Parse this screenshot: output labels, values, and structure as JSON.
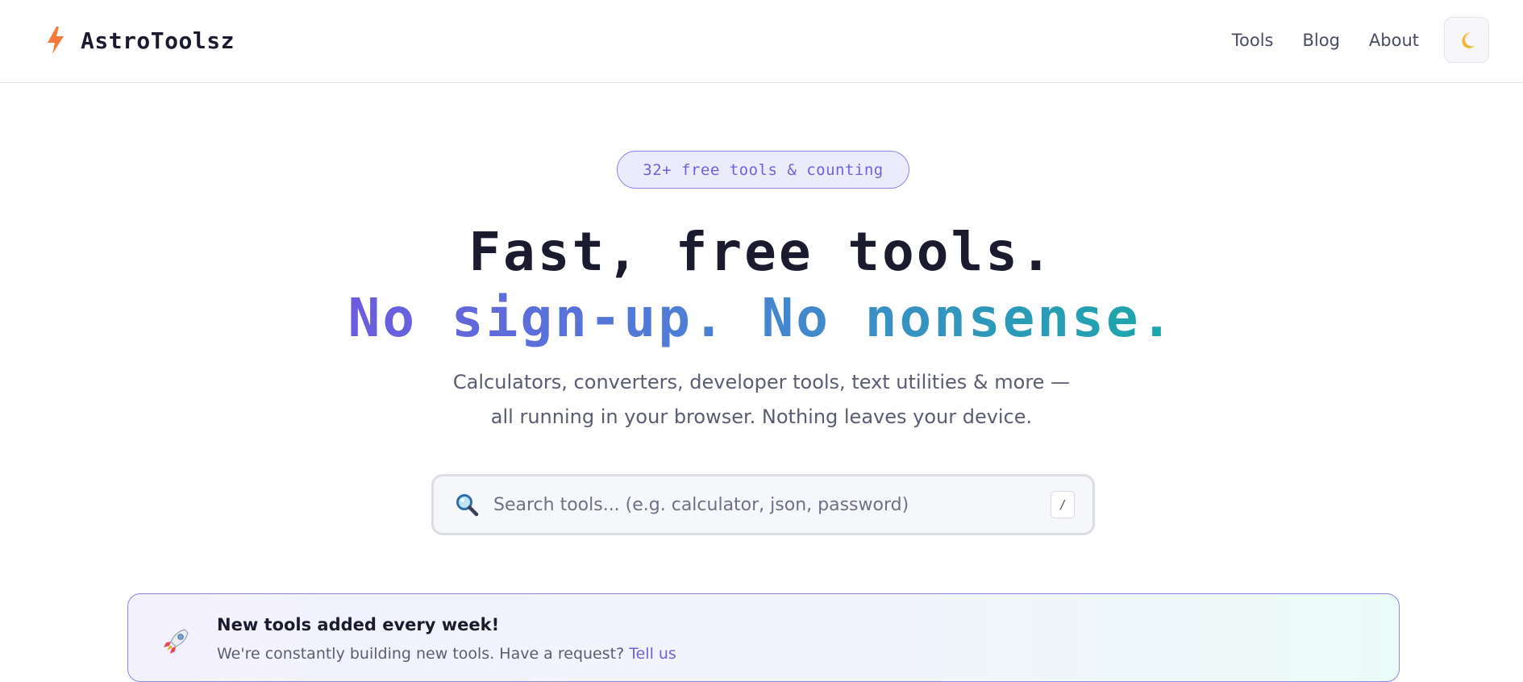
{
  "header": {
    "brand_name": "AstroToolsz",
    "nav": [
      "Tools",
      "Blog",
      "About"
    ],
    "theme_toggle_icon": "moon-icon"
  },
  "hero": {
    "badge": "32+ free tools & counting",
    "title_line1": "Fast, free tools.",
    "title_line2": "No sign-up. No nonsense.",
    "subtitle_line1": "Calculators, converters, developer tools, text utilities & more —",
    "subtitle_line2": "all running in your browser. Nothing leaves your device."
  },
  "search": {
    "placeholder": "Search tools... (e.g. calculator, json, password)",
    "value": "",
    "shortcut": "/",
    "icon": "search-icon"
  },
  "banner": {
    "icon": "rocket-icon",
    "title": "New tools added every week!",
    "text": "We're constantly building new tools. Have a request?",
    "link": "Tell us"
  },
  "colors": {
    "brand_bolt": "#f5793b",
    "accent_purple": "#6a65d6",
    "gradient_start": "#6d5be0",
    "gradient_end": "#1aa8a8",
    "text_dark": "#1b1b2f"
  }
}
